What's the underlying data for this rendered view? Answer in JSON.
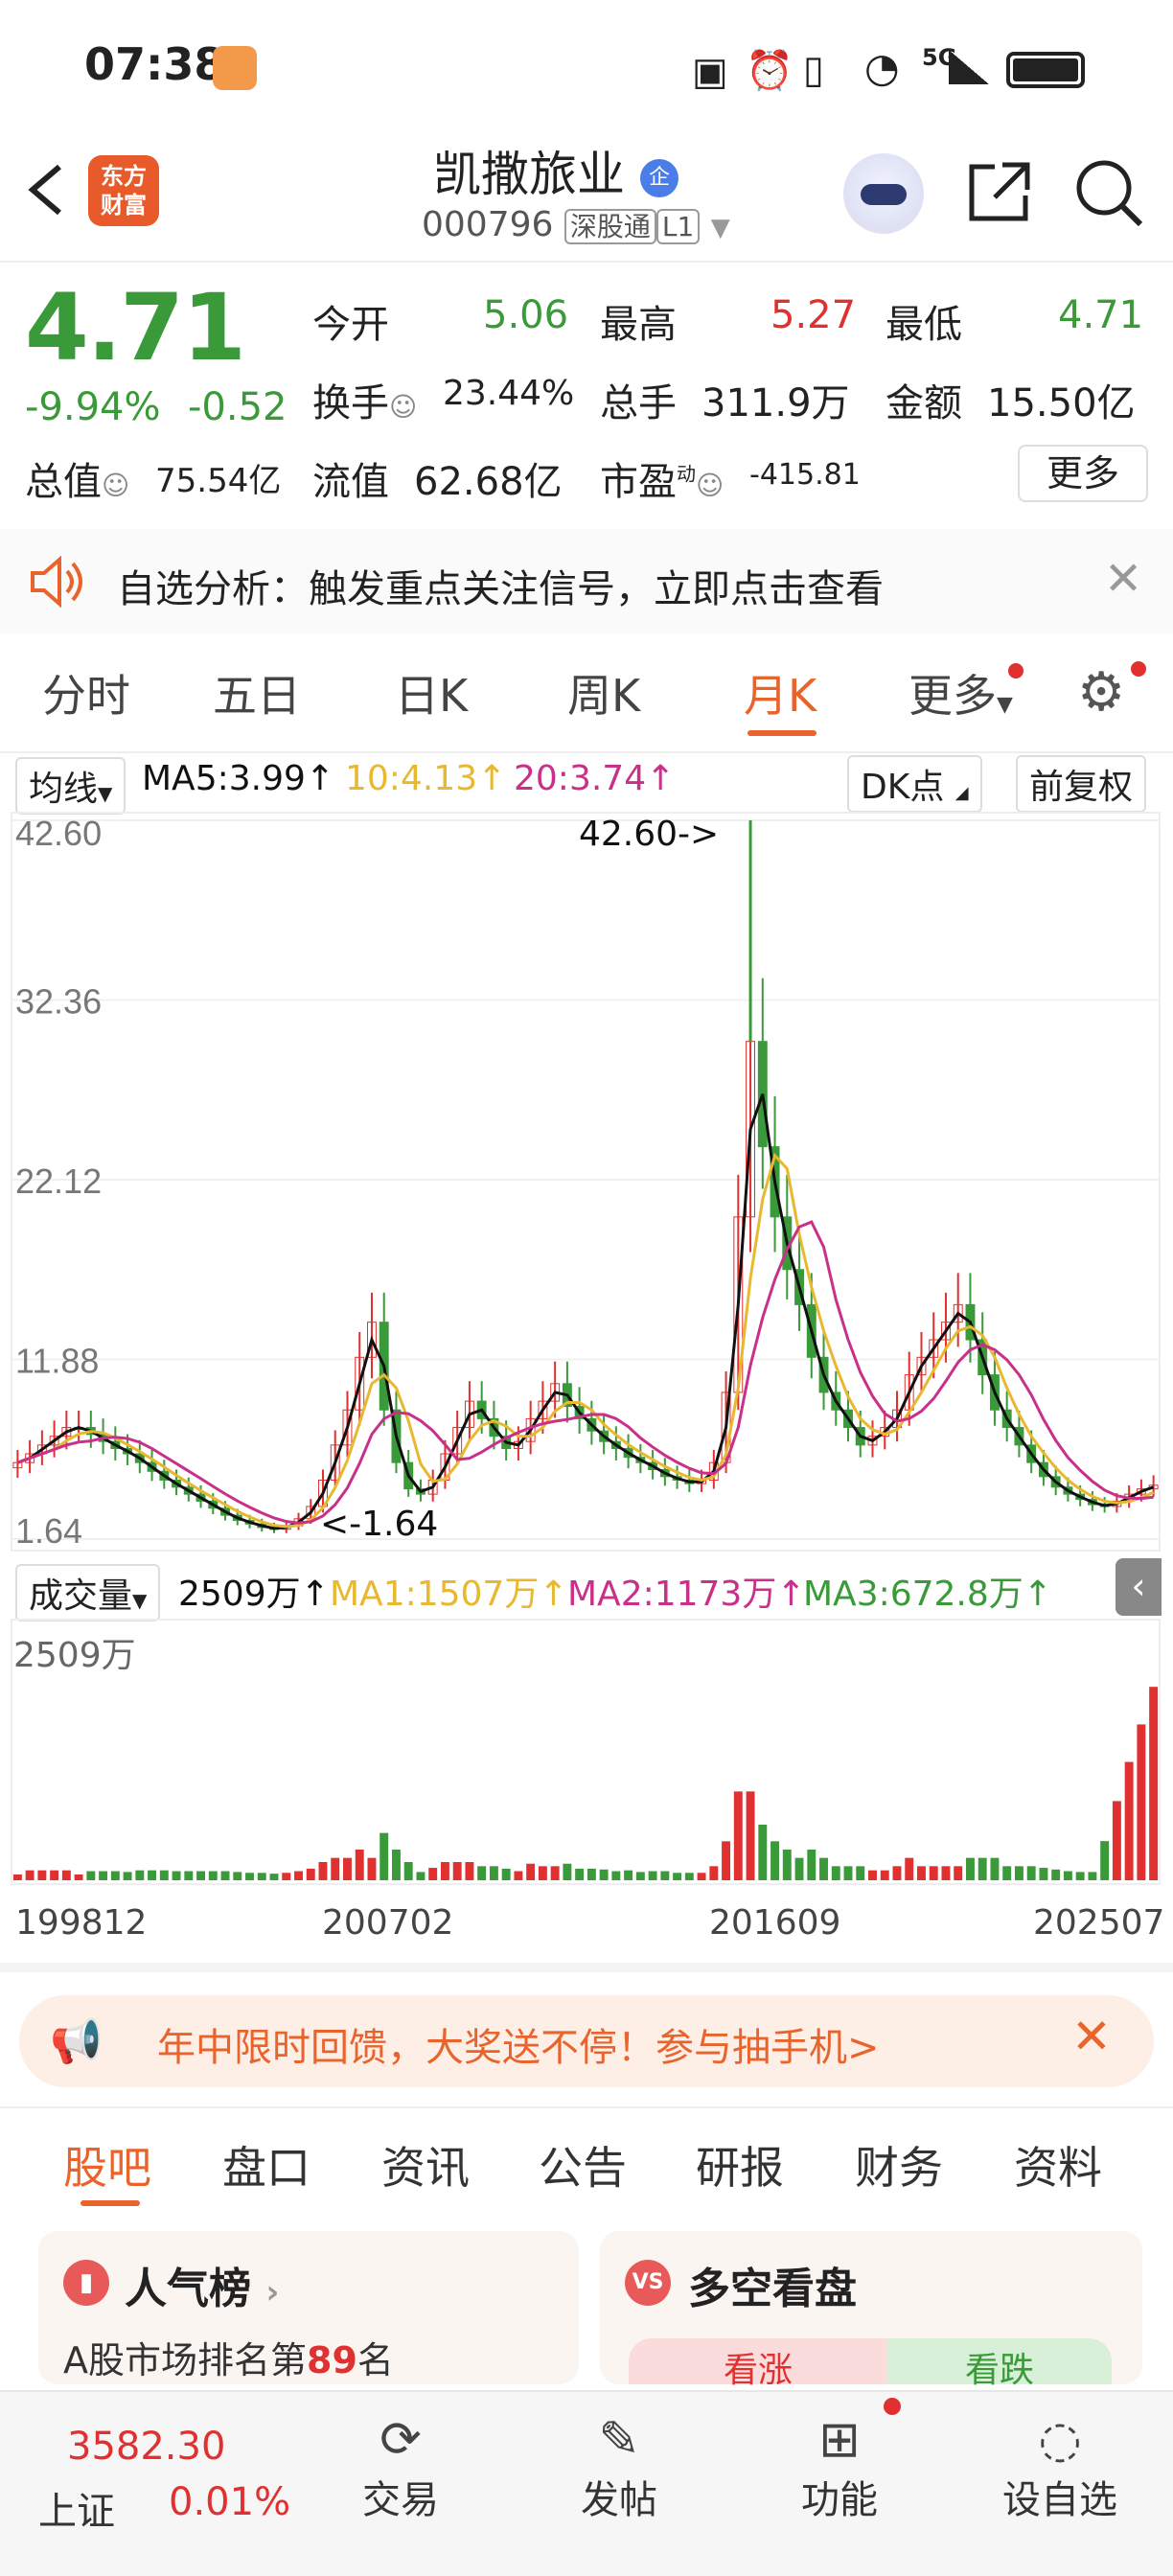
{
  "status_bar": {
    "time": "07:38",
    "network": "5G"
  },
  "header": {
    "logo_text_1": "东方",
    "logo_text_2": "财富",
    "title": "凯撒旅业",
    "title_badge": "企",
    "code": "000796",
    "tag1": "深股通",
    "tag2": "L1"
  },
  "quote": {
    "price": "4.71",
    "change_pct": "-9.94%",
    "change": "-0.52",
    "open_label": "今开",
    "open": "5.06",
    "high_label": "最高",
    "high": "5.27",
    "low_label": "最低",
    "low": "4.71",
    "turnover_label": "换手",
    "turnover": "23.44%",
    "volume_label": "总手",
    "volume": "311.9万",
    "amount_label": "金额",
    "amount": "15.50亿",
    "mcap_label": "总值",
    "mcap": "75.54亿",
    "float_label": "流值",
    "float": "62.68亿",
    "pe_label": "市盈",
    "pe_sup": "动",
    "pe": "-415.81",
    "more": "更多"
  },
  "analysis": {
    "text": "自选分析：触发重点关注信号，立即点击查看"
  },
  "tabs": [
    "分时",
    "五日",
    "日K",
    "周K",
    "月K",
    "更多"
  ],
  "active_tab": "月K",
  "chart_legend": {
    "ma_select": "均线",
    "ma5": "MA5:3.99↑",
    "ma10": "10:4.13↑",
    "ma20": "20:3.74↑",
    "dk": "DK点",
    "fuquan": "前复权"
  },
  "vol_legend": {
    "select": "成交量",
    "vol": "2509万↑",
    "ma1": "MA1:1507万↑",
    "ma2": "MA2:1173万↑",
    "ma3": "MA3:672.8万↑",
    "vmax": "2509万"
  },
  "chart_labels": {
    "max_note": "42.60->",
    "min_note": "<-1.64"
  },
  "colors": {
    "up": "#e03030",
    "down": "#3a9a3a",
    "accent": "#e8642c",
    "ma5": "#111111",
    "ma10": "#e8b830",
    "ma20": "#c8308a"
  },
  "chart_data": {
    "type": "candlestick",
    "y_ticks": [
      "42.60",
      "32.36",
      "22.12",
      "11.88",
      "1.64"
    ],
    "ylim": [
      1.64,
      42.6
    ],
    "x_ticks": [
      "199812",
      "200702",
      "201609",
      "202507"
    ],
    "close": [
      6,
      6.5,
      7,
      7.5,
      8,
      8,
      7.6,
      7.2,
      6.8,
      6.5,
      6,
      5.5,
      5,
      4.6,
      4.2,
      3.8,
      3.4,
      3.0,
      2.7,
      2.5,
      2.3,
      2.2,
      2.4,
      2.8,
      3.5,
      5,
      7,
      9,
      12,
      14,
      9,
      6,
      4.5,
      4.2,
      5,
      6.5,
      8,
      9.5,
      8.5,
      7.5,
      6.8,
      7.2,
      8.5,
      9.5,
      10.5,
      9.2,
      8.5,
      7.8,
      7.2,
      6.8,
      6.3,
      6,
      5.6,
      5.2,
      5,
      4.8,
      5,
      6,
      10,
      20,
      30,
      24,
      20,
      17,
      15,
      12,
      10,
      9,
      8,
      7,
      7.5,
      8,
      9,
      11,
      12,
      13,
      14,
      15,
      13,
      11,
      9,
      8,
      7,
      6,
      5.2,
      4.6,
      4.2,
      3.9,
      3.6,
      3.5,
      3.8,
      4.2,
      4.5,
      4.71
    ],
    "highs_note": "peak 42.60",
    "volume_max": "2509万"
  },
  "ad": {
    "text": "年中限时回馈，大奖送不停！参与抽手机>"
  },
  "sub_tabs": [
    "股吧",
    "盘口",
    "资讯",
    "公告",
    "研报",
    "财务",
    "资料"
  ],
  "active_sub_tab": "股吧",
  "cards": {
    "popular_title": "人气榜",
    "popular_rank_prefix": "A股市场排名第",
    "popular_rank": "89",
    "popular_rank_suffix": "名",
    "bull_bear_title": "多空看盘",
    "bull": "看涨",
    "bear": "看跌"
  },
  "bottom_bar": {
    "index_value": "3582.30",
    "index_name": "上证",
    "index_change": "0.01%",
    "trade": "交易",
    "post": "发帖",
    "func": "功能",
    "watch": "设自选"
  }
}
